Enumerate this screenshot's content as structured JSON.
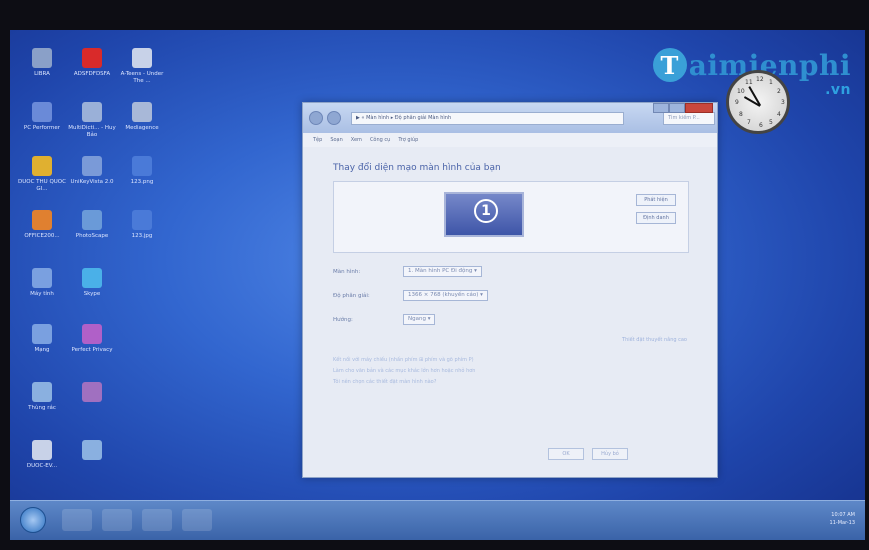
{
  "watermark": {
    "first_letter": "T",
    "rest": "aimienphi",
    "tld": ".vn"
  },
  "desktop": {
    "icons": [
      {
        "label": "LIBRA",
        "color": "#8aa0c8"
      },
      {
        "label": "ADSFDFDSFA",
        "color": "#d92a2a"
      },
      {
        "label": "A-Teens - Under The ...",
        "color": "#c8d2e8"
      },
      {
        "label": "PC Performer",
        "color": "#6a8ad8"
      },
      {
        "label": "MultiDicti... - Huy Bảo",
        "color": "#9ab0d8"
      },
      {
        "label": "Mediagence",
        "color": "#a8b8d8"
      },
      {
        "label": "DUOC THU QUOC GI...",
        "color": "#e0b030"
      },
      {
        "label": "UniKeyVista 2.0",
        "color": "#7a9ad8"
      },
      {
        "label": "123.png",
        "color": "#4a7ad8"
      },
      {
        "label": "OFFICE200...",
        "color": "#e08030"
      },
      {
        "label": "PhotoScape",
        "color": "#6a9ad8"
      },
      {
        "label": "123.jpg",
        "color": "#4a7ad8"
      },
      {
        "label": "Máy tính",
        "color": "#7aa0e0"
      },
      {
        "label": "Skype",
        "color": "#4ab0e8"
      },
      {
        "label": "Mạng",
        "color": "#7aa0e0"
      },
      {
        "label": "Perfect Privacy",
        "color": "#b060c8"
      },
      {
        "label": "Thùng rác",
        "color": "#8ab0e0"
      },
      {
        "label": "",
        "color": "#a070c0"
      },
      {
        "label": "DUOC-EV...",
        "color": "#c8d2e8"
      },
      {
        "label": "",
        "color": "#8ab0e0"
      }
    ]
  },
  "clock": {
    "numbers": [
      "12",
      "3",
      "6",
      "9",
      "1",
      "2",
      "4",
      "5",
      "7",
      "8",
      "10",
      "11"
    ]
  },
  "window": {
    "address": "▶ « Màn hình ▸ Độ phân giải Màn hình",
    "search_placeholder": "Tìm kiếm P...",
    "menu": [
      "Tệp",
      "Soạn",
      "Xem",
      "Công cụ",
      "Trợ giúp"
    ],
    "heading": "Thay đổi diện mạo màn hình của bạn",
    "monitor_number": "1",
    "detect_button": "Phát hiện",
    "identify_button": "Định danh",
    "fields": [
      {
        "label": "Màn hình:",
        "value": "1. Màn hình PC Đi động ▾"
      },
      {
        "label": "Độ phân giải:",
        "value": "1366 × 768 (khuyến cáo) ▾"
      },
      {
        "label": "Hướng:",
        "value": "Ngang ▾"
      }
    ],
    "advanced_link": "Thiết đặt thuyết nâng cao",
    "links": [
      "Kết nối với máy chiếu (nhấn phím ⊞ phím và gõ phím P)",
      "Làm cho văn bản và các mục khác lớn hơn hoặc nhỏ hơn",
      "Tôi nên chọn các thiết đặt màn hình nào?"
    ],
    "ok_button": "OK",
    "cancel_button": "Hủy bỏ"
  },
  "taskbar": {
    "time": "10:07 AM",
    "date": "11-Mar-13"
  }
}
